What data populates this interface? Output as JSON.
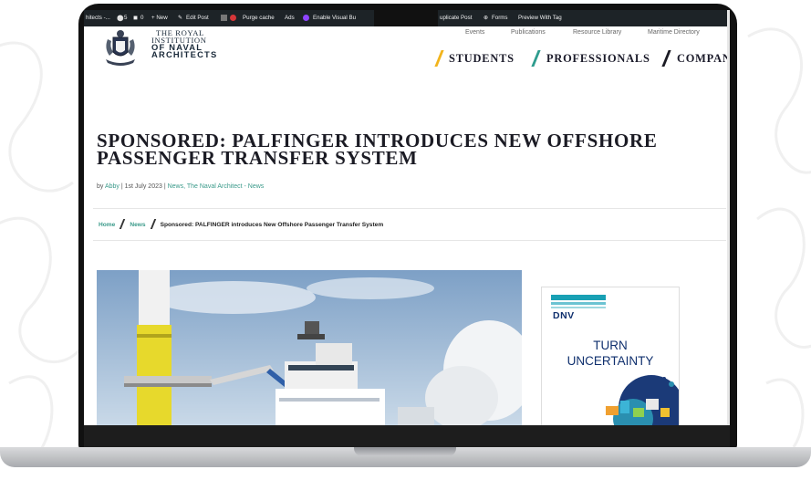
{
  "admin_bar": {
    "site": "hitects -...",
    "comments": "5",
    "updates": "0",
    "new": "+ New",
    "edit": "Edit Post",
    "purge": "Purge cache",
    "ads": "Ads",
    "visual": "Enable Visual Bu",
    "duplicate": "uplicate Post",
    "forms": "Forms",
    "preview": "Preview With Tag"
  },
  "header": {
    "logo_lines": [
      "THE ROYAL",
      "INSTITUTION",
      "OF NAVAL",
      "ARCHITECTS"
    ],
    "top_links": [
      "Events",
      "Publications",
      "Resource Library",
      "Maritime Directory"
    ],
    "main_nav": [
      "STUDENTS",
      "PROFESSIONALS",
      "COMPANI"
    ],
    "nav_slash_colors": [
      "#f2b41c",
      "#2e9c8e",
      "#1b1b24"
    ]
  },
  "article": {
    "title_lines": [
      "SPONSORED: PALFINGER INTRODUCES NEW OFFSHORE",
      "PASSENGER TRANSFER SYSTEM"
    ],
    "meta_by": "by ",
    "author": "Abby",
    "meta_date": " | 1st July 2023 | ",
    "categories": "News, The Naval Architect - News"
  },
  "breadcrumb": {
    "home": "Home",
    "news": "News",
    "current": "Sponsored: PALFINGER introduces New Offshore Passenger Transfer System"
  },
  "ad": {
    "brand": "DNV",
    "line1": "TURN",
    "line2": "UNCERTAINTY"
  },
  "colors": {
    "accent_teal": "#3a9a8a",
    "accent_yellow": "#f2b41c",
    "admin_bar": "#1d2327"
  }
}
